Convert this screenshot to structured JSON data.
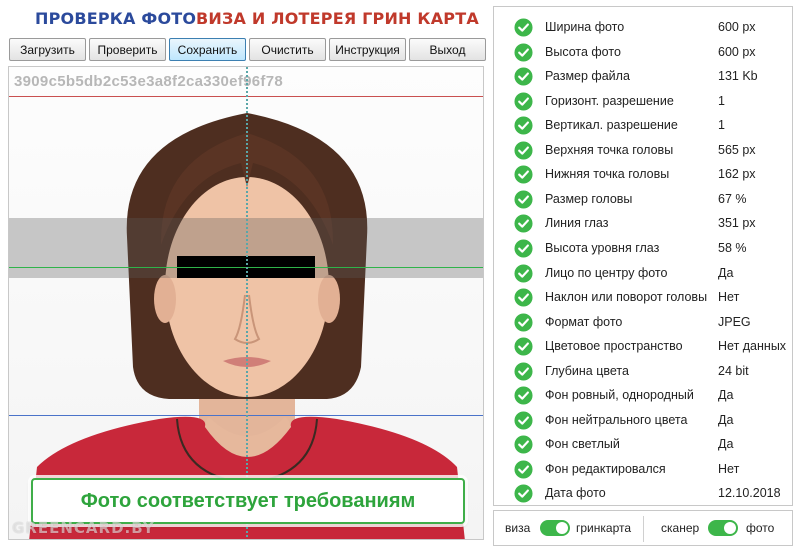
{
  "header": {
    "title_left": "ПРОВЕРКА ФОТО",
    "title_right": "ВИЗА И ЛОТЕРЕЯ ГРИН КАРТА"
  },
  "toolbar": {
    "load": "Загрузить",
    "check": "Проверить",
    "save": "Сохранить",
    "clear": "Очистить",
    "instructions": "Инструкция",
    "exit": "Выход",
    "active_button": "save"
  },
  "photo": {
    "hash": "3909c5b5db2c53e3a8f2ca330ef96f78",
    "status_message": "Фото соответствует требованиям",
    "watermark": "GREENCARD.BY"
  },
  "checks": [
    {
      "label": "Ширина фото",
      "value": "600 px",
      "ok": true
    },
    {
      "label": "Высота фото",
      "value": "600 px",
      "ok": true
    },
    {
      "label": "Размер файла",
      "value": "131 Kb",
      "ok": true
    },
    {
      "label": "Горизонт. разрешение",
      "value": "1",
      "ok": true
    },
    {
      "label": "Вертикал. разрешение",
      "value": "1",
      "ok": true
    },
    {
      "label": "Верхняя точка головы",
      "value": "565 px",
      "ok": true
    },
    {
      "label": "Нижняя точка головы",
      "value": "162 px",
      "ok": true
    },
    {
      "label": "Размер головы",
      "value": "67 %",
      "ok": true
    },
    {
      "label": "Линия глаз",
      "value": "351 px",
      "ok": true
    },
    {
      "label": "Высота уровня глаз",
      "value": "58 %",
      "ok": true
    },
    {
      "label": "Лицо по центру фото",
      "value": "Да",
      "ok": true
    },
    {
      "label": "Наклон или поворот головы",
      "value": "Нет",
      "ok": true
    },
    {
      "label": "Формат фото",
      "value": "JPEG",
      "ok": true
    },
    {
      "label": "Цветовое пространство",
      "value": "Нет данных",
      "ok": true
    },
    {
      "label": "Глубина цвета",
      "value": "24 bit",
      "ok": true
    },
    {
      "label": "Фон ровный, однородный",
      "value": "Да",
      "ok": true
    },
    {
      "label": "Фон нейтрального цвета",
      "value": "Да",
      "ok": true
    },
    {
      "label": "Фон светлый",
      "value": "Да",
      "ok": true
    },
    {
      "label": "Фон редактировался",
      "value": "Нет",
      "ok": true
    },
    {
      "label": "Дата фото",
      "value": "12.10.2018",
      "ok": true
    }
  ],
  "toggles": {
    "left_off": "виза",
    "left_on": "гринкарта",
    "right_off": "сканер",
    "right_on": "фото"
  },
  "colors": {
    "title_blue": "#2b4a9c",
    "title_red": "#c0392b",
    "ok_green": "#3db64a",
    "status_green": "#2ea43c"
  },
  "icons": {
    "check": "check-circle-icon"
  }
}
